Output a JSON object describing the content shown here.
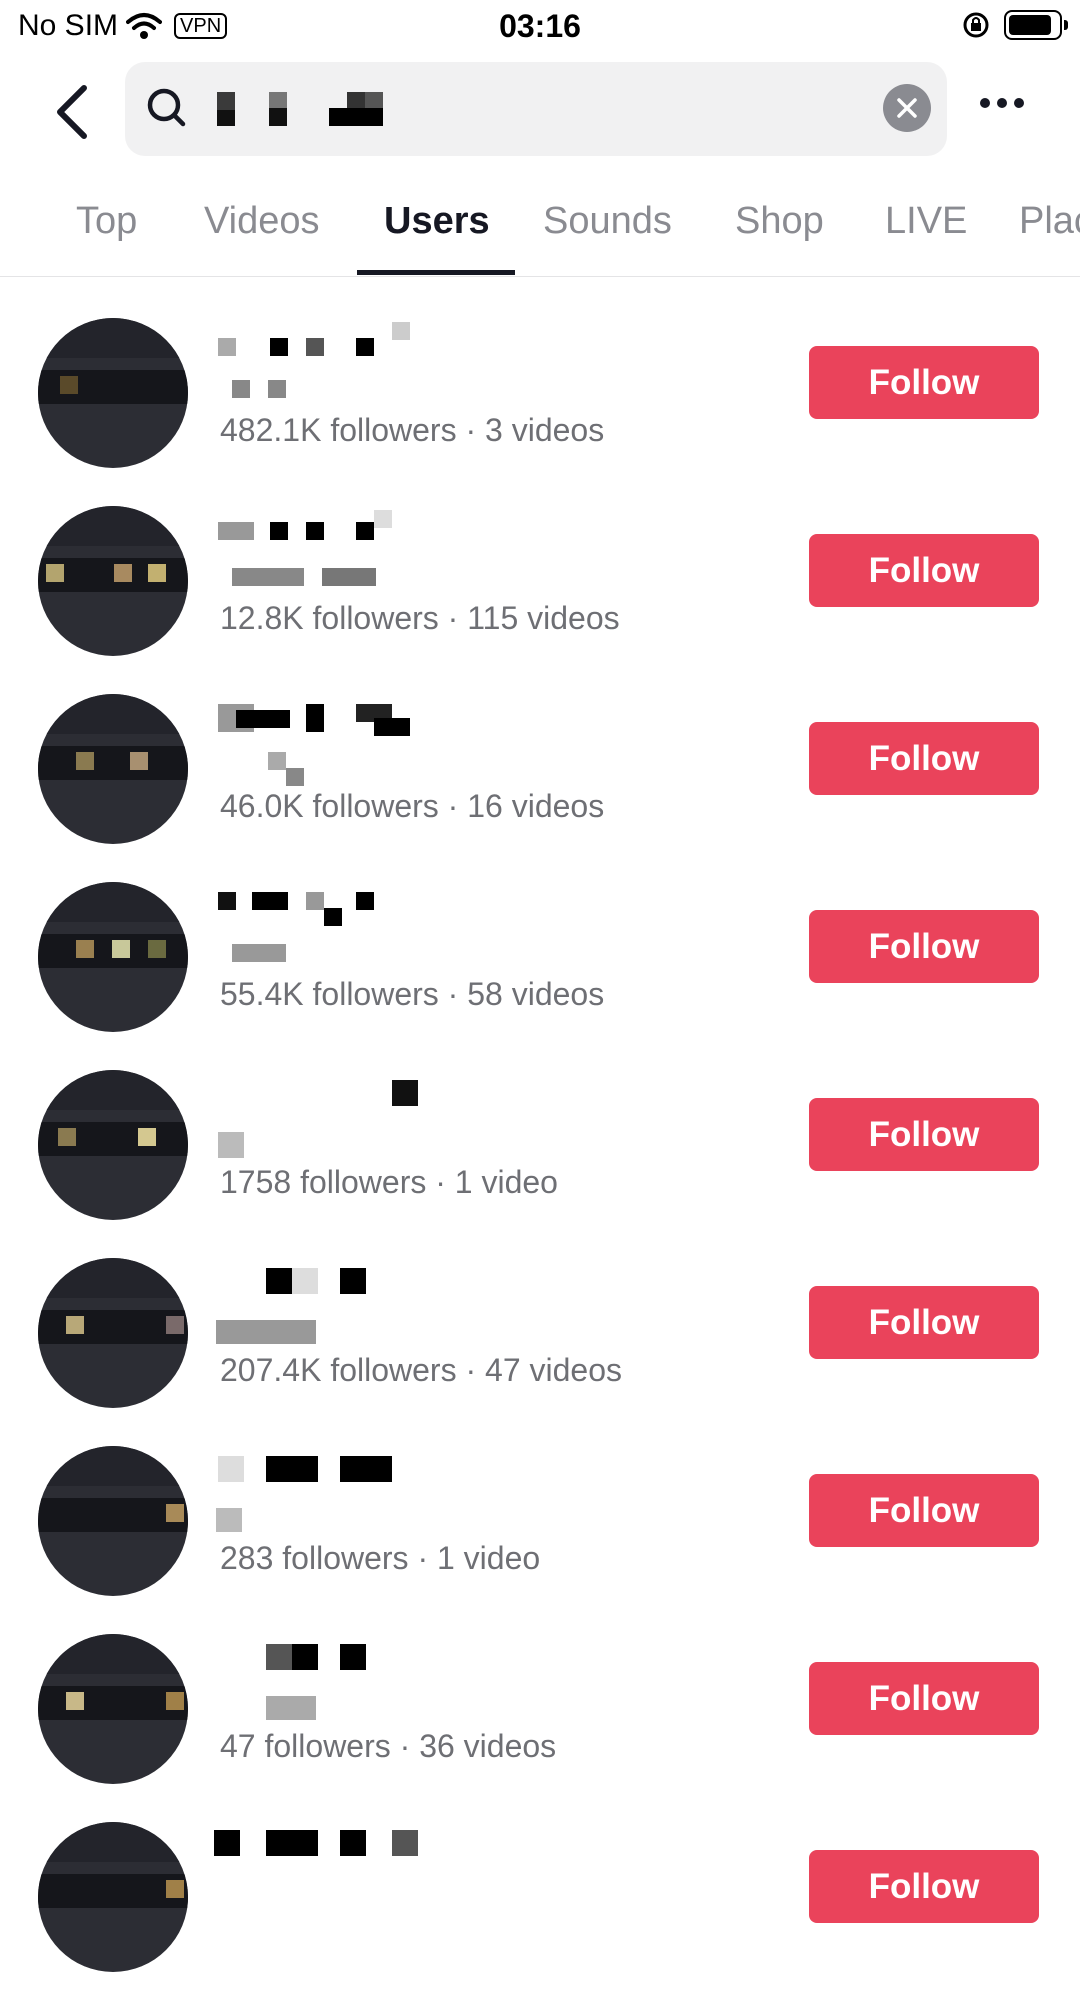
{
  "status_bar": {
    "carrier": "No SIM",
    "vpn": "VPN",
    "time": "03:16"
  },
  "search": {
    "placeholder": "",
    "query_obscured": true
  },
  "tabs": [
    {
      "label": "Top",
      "active": false
    },
    {
      "label": "Videos",
      "active": false
    },
    {
      "label": "Users",
      "active": true
    },
    {
      "label": "Sounds",
      "active": false
    },
    {
      "label": "Shop",
      "active": false
    },
    {
      "label": "LIVE",
      "active": false
    },
    {
      "label": "Plac",
      "active": false
    }
  ],
  "users": [
    {
      "stats": "482.1K followers · 3 videos",
      "follow_label": "Follow"
    },
    {
      "stats": "12.8K followers · 115 videos",
      "follow_label": "Follow"
    },
    {
      "stats": "46.0K followers · 16 videos",
      "follow_label": "Follow"
    },
    {
      "stats": "55.4K followers · 58 videos",
      "follow_label": "Follow"
    },
    {
      "stats": "1758 followers · 1 video",
      "follow_label": "Follow"
    },
    {
      "stats": "207.4K followers · 47 videos",
      "follow_label": "Follow"
    },
    {
      "stats": "283 followers · 1 video",
      "follow_label": "Follow"
    },
    {
      "stats": "47 followers · 36 videos",
      "follow_label": "Follow"
    },
    {
      "stats": "",
      "follow_label": "Follow"
    }
  ],
  "colors": {
    "follow_button": "#ea435b",
    "active_tab": "#161823",
    "inactive_tab": "#8a8b91",
    "secondary_text": "#6e6f74"
  }
}
